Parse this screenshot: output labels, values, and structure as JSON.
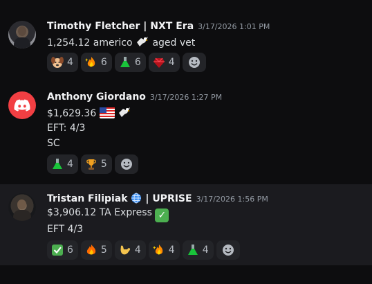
{
  "messages": [
    {
      "author": "Timothy Fletcher | NXT Era",
      "timestamp": "3/17/2026 1:01 PM",
      "lines": [
        "1,254.12 americo",
        "aged vet"
      ],
      "reactions": [
        {
          "icon": "dog-face-icon",
          "count": "4"
        },
        {
          "icon": "fire-sparkle-icon",
          "count": "6"
        },
        {
          "icon": "green-flask-icon",
          "count": "6"
        },
        {
          "icon": "red-gem-icon",
          "count": "4"
        }
      ]
    },
    {
      "author": "Anthony Giordano",
      "timestamp": "3/17/2026 1:27 PM",
      "lines": [
        "$1,629.36",
        "EFT: 4/3",
        "SC"
      ],
      "reactions": [
        {
          "icon": "green-flask-icon",
          "count": "4"
        },
        {
          "icon": "trophy-icon",
          "count": "5"
        }
      ]
    },
    {
      "author": "Tristan Filipiak",
      "author_suffix": "| UPRISE",
      "timestamp": "3/17/2026 1:56 PM",
      "lines": [
        "$3,906.12 TA Express",
        "EFT 4/3"
      ],
      "reactions": [
        {
          "icon": "check-mark-icon",
          "count": "6"
        },
        {
          "icon": "fire-icon",
          "count": "5"
        },
        {
          "icon": "call-me-hand-icon",
          "count": "4"
        },
        {
          "icon": "fire-sparkle-icon",
          "count": "4"
        },
        {
          "icon": "green-flask-icon",
          "count": "4"
        }
      ]
    }
  ],
  "colors": {
    "background": "#0d0d0f",
    "hover_row": "#1b1b1f",
    "reaction_bg": "#232428",
    "discord_red": "#f23f43"
  }
}
